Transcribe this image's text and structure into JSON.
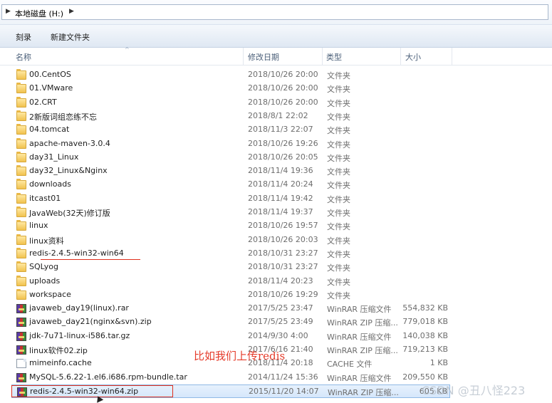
{
  "address": {
    "arrow": "▶",
    "path": "本地磁盘 (H:)",
    "arrow2": "▶"
  },
  "toolbar": {
    "burn": "刻录",
    "new_folder": "新建文件夹"
  },
  "columns": {
    "name": "名称",
    "date": "修改日期",
    "type": "类型",
    "size": "大小"
  },
  "rows": [
    {
      "name": "00.CentOS",
      "date": "2018/10/26 20:00",
      "type": "文件夹",
      "size": "",
      "icon": "folder-icon"
    },
    {
      "name": "01.VMware",
      "date": "2018/10/26 20:00",
      "type": "文件夹",
      "size": "",
      "icon": "folder-icon"
    },
    {
      "name": "02.CRT",
      "date": "2018/10/26 20:00",
      "type": "文件夹",
      "size": "",
      "icon": "folder-icon"
    },
    {
      "name": "2新版词组恋练不忘",
      "date": "2018/8/1 22:02",
      "type": "文件夹",
      "size": "",
      "icon": "folder-icon"
    },
    {
      "name": "04.tomcat",
      "date": "2018/11/3 22:07",
      "type": "文件夹",
      "size": "",
      "icon": "folder-icon"
    },
    {
      "name": "apache-maven-3.0.4",
      "date": "2018/10/26 19:26",
      "type": "文件夹",
      "size": "",
      "icon": "folder-icon"
    },
    {
      "name": "day31_Linux",
      "date": "2018/10/26 20:05",
      "type": "文件夹",
      "size": "",
      "icon": "folder-icon"
    },
    {
      "name": "day32_Linux&Nginx",
      "date": "2018/11/4 19:36",
      "type": "文件夹",
      "size": "",
      "icon": "folder-icon"
    },
    {
      "name": "downloads",
      "date": "2018/11/4 20:24",
      "type": "文件夹",
      "size": "",
      "icon": "folder-icon"
    },
    {
      "name": "itcast01",
      "date": "2018/11/4 19:42",
      "type": "文件夹",
      "size": "",
      "icon": "folder-icon"
    },
    {
      "name": "JavaWeb(32天)修订版",
      "date": "2018/11/4 19:37",
      "type": "文件夹",
      "size": "",
      "icon": "folder-icon"
    },
    {
      "name": "linux",
      "date": "2018/10/26 19:57",
      "type": "文件夹",
      "size": "",
      "icon": "folder-icon"
    },
    {
      "name": "linux资料",
      "date": "2018/10/26 20:03",
      "type": "文件夹",
      "size": "",
      "icon": "folder-icon"
    },
    {
      "name": "redis-2.4.5-win32-win64",
      "date": "2018/10/31 23:27",
      "type": "文件夹",
      "size": "",
      "icon": "folder-icon"
    },
    {
      "name": "SQLyog",
      "date": "2018/10/31 23:27",
      "type": "文件夹",
      "size": "",
      "icon": "folder-icon"
    },
    {
      "name": "uploads",
      "date": "2018/11/4 20:23",
      "type": "文件夹",
      "size": "",
      "icon": "folder-icon"
    },
    {
      "name": "workspace",
      "date": "2018/10/26 19:29",
      "type": "文件夹",
      "size": "",
      "icon": "folder-icon"
    },
    {
      "name": "javaweb_day19(linux).rar",
      "date": "2017/5/25 23:47",
      "type": "WinRAR 压缩文件",
      "size": "554,832 KB",
      "icon": "winrar-icon"
    },
    {
      "name": "javaweb_day21(nginx&svn).zip",
      "date": "2017/5/25 23:49",
      "type": "WinRAR ZIP 压缩...",
      "size": "779,018 KB",
      "icon": "winrar-icon"
    },
    {
      "name": "jdk-7u71-linux-i586.tar.gz",
      "date": "2014/9/30 4:00",
      "type": "WinRAR 压缩文件",
      "size": "140,038 KB",
      "icon": "winrar-icon"
    },
    {
      "name": "linux软件02.zip",
      "date": "2017/6/16 21:40",
      "type": "WinRAR ZIP 压缩...",
      "size": "719,213 KB",
      "icon": "winrar-icon"
    },
    {
      "name": "mimeinfo.cache",
      "date": "2018/11/4 20:18",
      "type": "CACHE 文件",
      "size": "1 KB",
      "icon": "file-icon"
    },
    {
      "name": "MySQL-5.6.22-1.el6.i686.rpm-bundle.tar",
      "date": "2014/11/24 15:36",
      "type": "WinRAR 压缩文件",
      "size": "209,550 KB",
      "icon": "winrar-icon"
    },
    {
      "name": "redis-2.4.5-win32-win64.zip",
      "date": "2015/11/20 14:07",
      "type": "WinRAR ZIP 压缩...",
      "size": "605 KB",
      "icon": "winrar-icon",
      "selected": true
    }
  ],
  "annotation_text": "比如我们上传redis",
  "watermark": "CSDN @丑八怪223"
}
